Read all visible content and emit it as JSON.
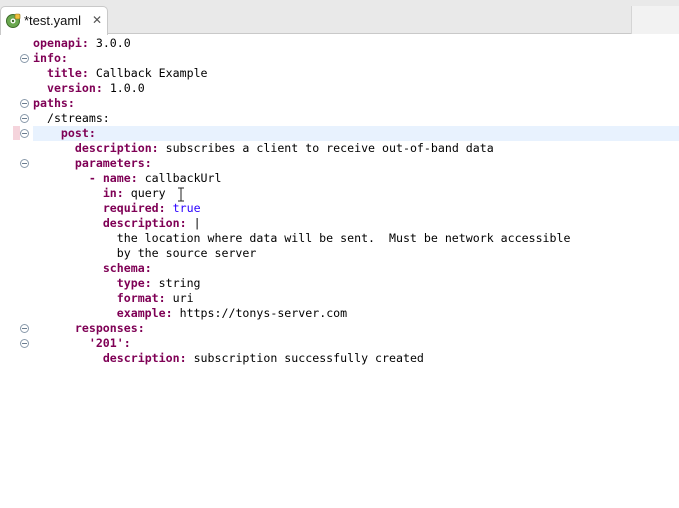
{
  "tab": {
    "label": "*test.yaml",
    "icon": "yaml-file-icon",
    "close_icon": "close-icon"
  },
  "editor": {
    "current_line": 6,
    "lines": [
      {
        "indent": "",
        "key": "openapi",
        "value": "3.0.0",
        "fold": false
      },
      {
        "indent": "",
        "key": "info",
        "value": "",
        "fold": true
      },
      {
        "indent": "  ",
        "key": "title",
        "value": "Callback Example",
        "fold": false
      },
      {
        "indent": "  ",
        "key": "version",
        "value": "1.0.0",
        "fold": false
      },
      {
        "indent": "",
        "key": "paths",
        "value": "",
        "fold": true
      },
      {
        "indent": "  ",
        "key": "",
        "value": "/streams:",
        "fold": true
      },
      {
        "indent": "    ",
        "key": "post",
        "value": "",
        "fold": true
      },
      {
        "indent": "      ",
        "key": "description",
        "value": "subscribes a client to receive out-of-band data",
        "fold": false
      },
      {
        "indent": "      ",
        "key": "parameters",
        "value": "",
        "fold": true
      },
      {
        "indent": "        - ",
        "key": "name",
        "value": "callbackUrl",
        "fold": false,
        "dash": true
      },
      {
        "indent": "          ",
        "key": "in",
        "value": "query",
        "fold": false
      },
      {
        "indent": "          ",
        "key": "required",
        "value": "true",
        "fold": false,
        "bool": true
      },
      {
        "indent": "          ",
        "key": "description",
        "value": "|",
        "fold": false
      },
      {
        "indent": "            ",
        "key": "",
        "value": "the location where data will be sent.  Must be network accessible",
        "fold": false
      },
      {
        "indent": "            ",
        "key": "",
        "value": "by the source server",
        "fold": false
      },
      {
        "indent": "          ",
        "key": "schema",
        "value": "",
        "fold": false
      },
      {
        "indent": "            ",
        "key": "type",
        "value": "string",
        "fold": false
      },
      {
        "indent": "            ",
        "key": "format",
        "value": "uri",
        "fold": false
      },
      {
        "indent": "            ",
        "key": "example",
        "value": "https://tonys-server.com",
        "fold": false
      },
      {
        "indent": "      ",
        "key": "responses",
        "value": "",
        "fold": true
      },
      {
        "indent": "        ",
        "key": "'201'",
        "value": "",
        "fold": true,
        "quoted": true
      },
      {
        "indent": "          ",
        "key": "description",
        "value": "subscription successfully created",
        "fold": false
      }
    ]
  },
  "colors": {
    "key": "#7f0055",
    "boolean": "#2a00ff",
    "current_line": "#e8f2fe",
    "marker": "#f5d4dc"
  }
}
